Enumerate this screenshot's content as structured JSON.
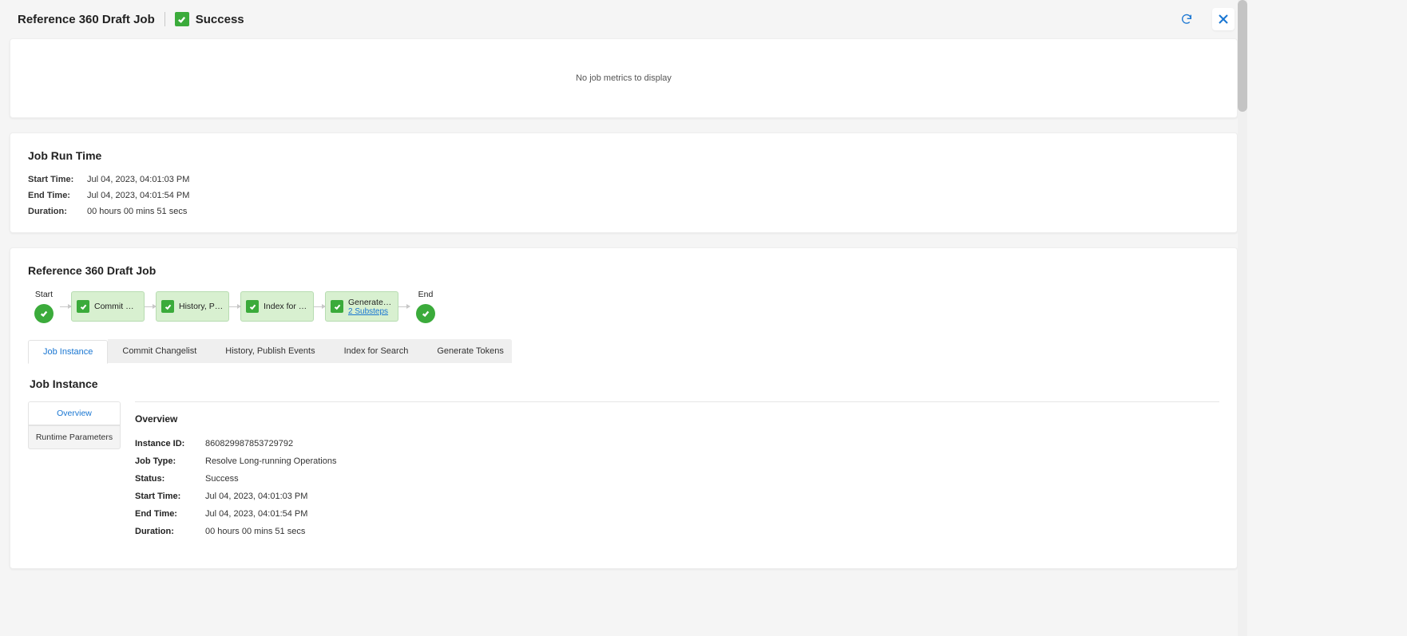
{
  "header": {
    "title": "Reference 360 Draft Job",
    "status_label": "Success"
  },
  "metrics": {
    "empty_text": "No job metrics to display"
  },
  "runtime": {
    "title": "Job Run Time",
    "start_label": "Start Time:",
    "start_value": "Jul 04, 2023, 04:01:03 PM",
    "end_label": "End Time:",
    "end_value": "Jul 04, 2023, 04:01:54 PM",
    "duration_label": "Duration:",
    "duration_value": "00 hours 00 mins 51 secs"
  },
  "workflow": {
    "title": "Reference 360 Draft Job",
    "start": "Start",
    "end": "End",
    "steps": [
      {
        "label": "Commit Ch…"
      },
      {
        "label": "History, Pu…"
      },
      {
        "label": "Index for S…"
      },
      {
        "label": "Generate T…",
        "sub": "2 Substeps"
      }
    ],
    "tabs": [
      "Job Instance",
      "Commit Changelist",
      "History, Publish Events",
      "Index for Search",
      "Generate Tokens"
    ]
  },
  "job_instance": {
    "heading": "Job Instance",
    "vtabs": [
      "Overview",
      "Runtime Parameters"
    ],
    "overview": {
      "title": "Overview",
      "rows": [
        {
          "label": "Instance ID:",
          "value": "860829987853729792"
        },
        {
          "label": "Job Type:",
          "value": "Resolve Long-running Operations"
        },
        {
          "label": "Status:",
          "value": "Success"
        },
        {
          "label": "Start Time:",
          "value": "Jul 04, 2023, 04:01:03 PM"
        },
        {
          "label": "End Time:",
          "value": "Jul 04, 2023, 04:01:54 PM"
        },
        {
          "label": "Duration:",
          "value": "00 hours 00 mins 51 secs"
        }
      ]
    }
  }
}
